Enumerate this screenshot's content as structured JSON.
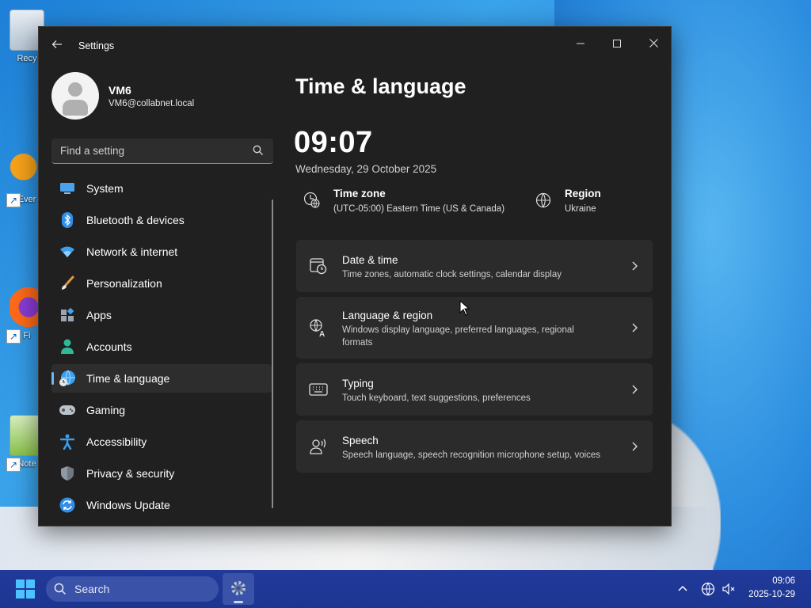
{
  "colors": {
    "window_bg": "#202020",
    "card_bg": "#2b2b2b",
    "accent": "#6cb8f6",
    "taskbar_bg": "#213a9b"
  },
  "desktop": {
    "icons": [
      {
        "label": "Recy",
        "icon": "recycle-bin-icon"
      },
      {
        "label": "Ever",
        "icon": "everything-app-icon"
      },
      {
        "label": "Fi",
        "icon": "firefox-icon"
      },
      {
        "label": "Note",
        "icon": "notepad-plus-plus-icon"
      }
    ]
  },
  "window": {
    "title": "Settings",
    "controls": {
      "minimize": "—",
      "maximize": "☐",
      "close": "✕"
    }
  },
  "profile": {
    "name": "VM6",
    "email": "VM6@collabnet.local"
  },
  "search": {
    "placeholder": "Find a setting"
  },
  "nav": {
    "items": [
      {
        "label": "System",
        "icon": "system-monitor-icon"
      },
      {
        "label": "Bluetooth & devices",
        "icon": "bluetooth-icon"
      },
      {
        "label": "Network & internet",
        "icon": "wifi-icon"
      },
      {
        "label": "Personalization",
        "icon": "paintbrush-icon"
      },
      {
        "label": "Apps",
        "icon": "apps-icon"
      },
      {
        "label": "Accounts",
        "icon": "person-icon"
      },
      {
        "label": "Time & language",
        "icon": "globe-clock-icon",
        "active": true
      },
      {
        "label": "Gaming",
        "icon": "gamepad-icon"
      },
      {
        "label": "Accessibility",
        "icon": "accessibility-icon"
      },
      {
        "label": "Privacy & security",
        "icon": "shield-icon"
      },
      {
        "label": "Windows Update",
        "icon": "update-icon"
      }
    ]
  },
  "main": {
    "title": "Time & language",
    "clock": "09:07",
    "date": "Wednesday, 29 October 2025",
    "timezone": {
      "title": "Time zone",
      "value": "(UTC-05:00) Eastern Time (US & Canada)"
    },
    "region": {
      "title": "Region",
      "value": "Ukraine"
    },
    "cards": [
      {
        "title": "Date & time",
        "subtitle": "Time zones, automatic clock settings, calendar display",
        "icon": "calendar-clock-icon"
      },
      {
        "title": "Language & region",
        "subtitle": "Windows display language, preferred languages, regional formats",
        "icon": "language-icon"
      },
      {
        "title": "Typing",
        "subtitle": "Touch keyboard, text suggestions, preferences",
        "icon": "keyboard-icon"
      },
      {
        "title": "Speech",
        "subtitle": "Speech language, speech recognition microphone setup, voices",
        "icon": "speech-icon"
      }
    ]
  },
  "taskbar": {
    "search_label": "Search",
    "time": "09:06",
    "date": "2025-10-29"
  }
}
